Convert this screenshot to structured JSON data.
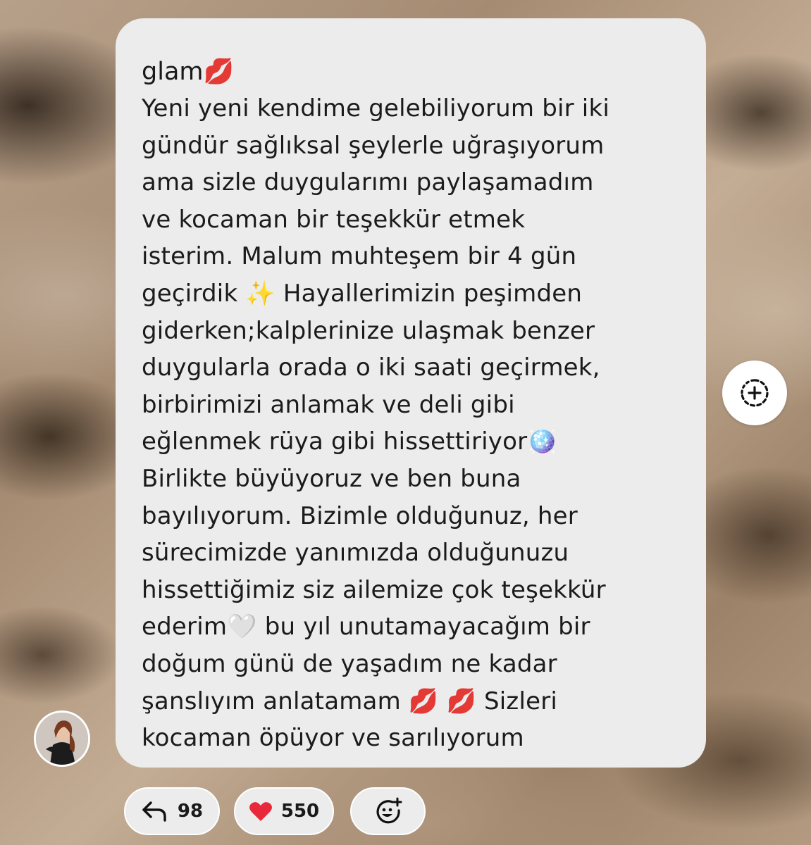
{
  "message": {
    "sender": "glam",
    "sender_emoji": "💋",
    "lines": [
      "Yeni yeni kendime gelebiliyorum bir iki",
      "gündür sağlıksal şeylerle uğraşıyorum",
      "ama sizle duygularımı paylaşamadım",
      "ve kocaman bir teşekkür etmek",
      "isterim. Malum muhteşem bir 4 gün",
      "geçirdik ✨ Hayallerimizin peşimden",
      "giderken;kalplerinize ulaşmak benzer",
      "duygularla orada o iki saati geçirmek,",
      "birbirimizi anlamak ve deli gibi",
      "eğlenmek rüya gibi hissettiriyor🪩",
      "Birlikte büyüyoruz ve ben buna",
      "bayılıyorum. Bizimle olduğunuz, her",
      "sürecimizde yanımızda olduğunuzu",
      "hissettiğimiz siz ailemize çok teşekkür",
      "ederim🤍 bu yıl unutamayacağım bir",
      "doğum günü de yaşadım ne kadar",
      "şanslıyım anlatamam 💋 💋 Sizleri",
      "kocaman öpüyor ve sarılıyorum"
    ]
  },
  "actions": {
    "reply_count": "98",
    "like_emoji": "❤️",
    "like_count": "550"
  },
  "icons": {
    "reply": "reply-arrow-icon",
    "like": "heart-icon",
    "add_reaction": "add-reaction-icon",
    "add_sticker": "add-sticker-icon"
  }
}
